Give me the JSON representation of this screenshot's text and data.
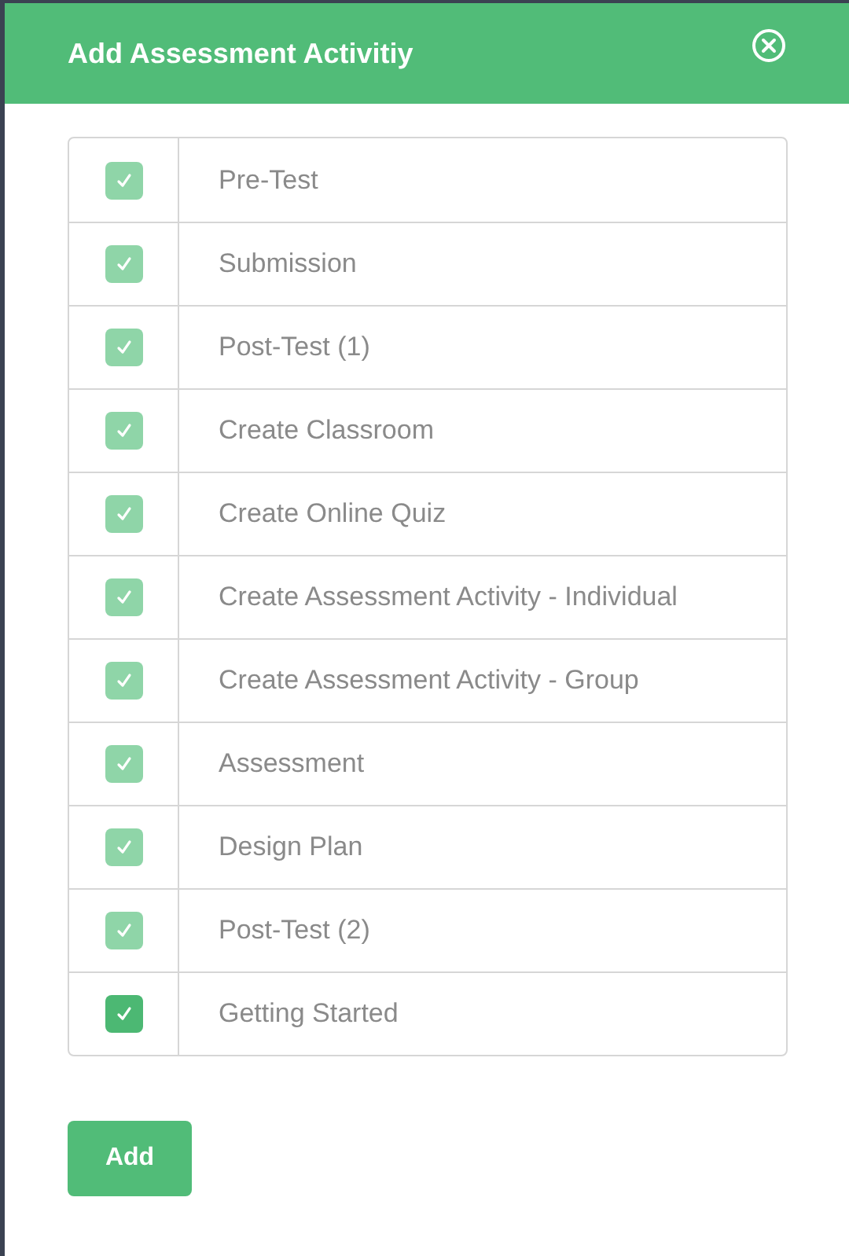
{
  "dialog": {
    "title": "Add Assessment Activitiy"
  },
  "items": [
    {
      "label": "Pre-Test",
      "checked": true,
      "disabled": true
    },
    {
      "label": "Submission",
      "checked": true,
      "disabled": true
    },
    {
      "label": "Post-Test (1)",
      "checked": true,
      "disabled": true
    },
    {
      "label": "Create Classroom",
      "checked": true,
      "disabled": true
    },
    {
      "label": "Create Online Quiz",
      "checked": true,
      "disabled": true
    },
    {
      "label": "Create Assessment Activity - Individual",
      "checked": true,
      "disabled": true
    },
    {
      "label": "Create Assessment Activity - Group",
      "checked": true,
      "disabled": true
    },
    {
      "label": "Assessment",
      "checked": true,
      "disabled": true
    },
    {
      "label": "Design Plan",
      "checked": true,
      "disabled": true
    },
    {
      "label": "Post-Test (2)",
      "checked": true,
      "disabled": true
    },
    {
      "label": "Getting Started",
      "checked": true,
      "disabled": false
    }
  ],
  "buttons": [
    {
      "label": "Add"
    }
  ]
}
